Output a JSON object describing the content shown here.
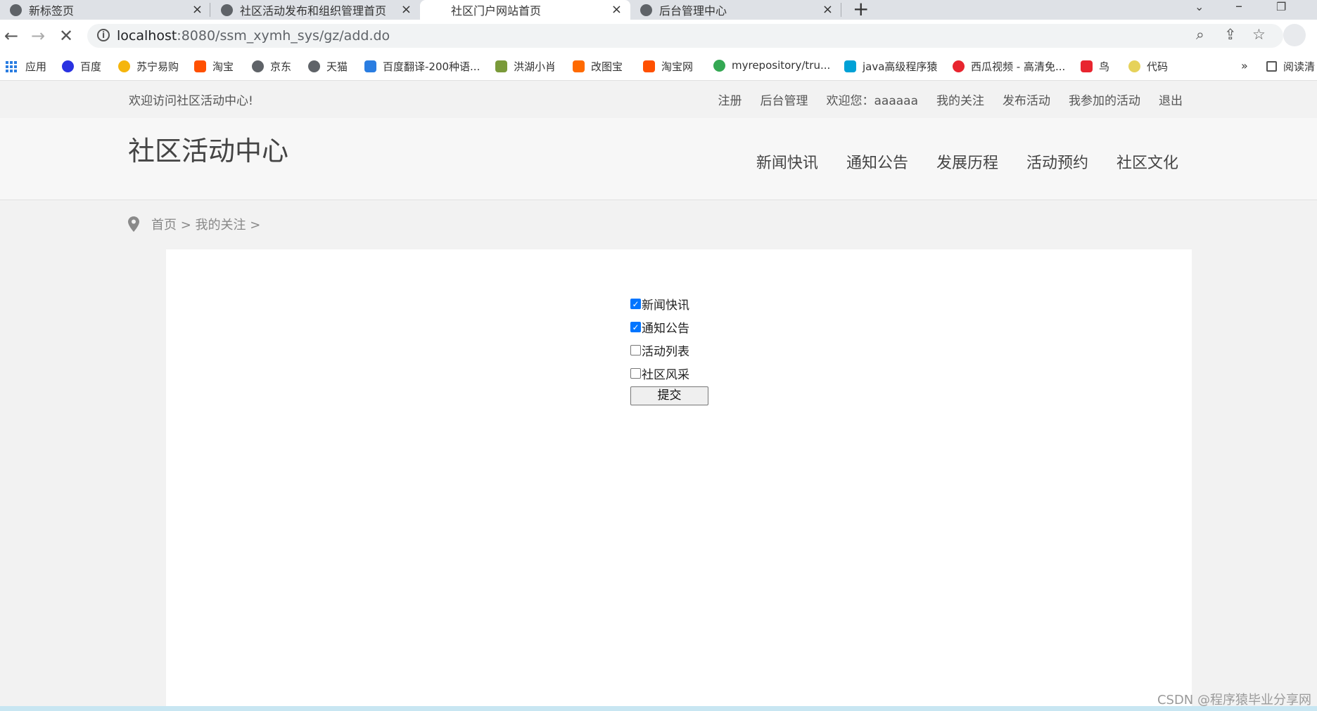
{
  "browser": {
    "tabs": [
      {
        "title": "新标签页",
        "active": false
      },
      {
        "title": "社区活动发布和组织管理首页",
        "active": false
      },
      {
        "title": "社区门户网站首页",
        "active": true
      },
      {
        "title": "后台管理中心",
        "active": false
      }
    ],
    "url_host": "localhost",
    "url_rest": ":8080/ssm_xymh_sys/gz/add.do",
    "bookmarks": [
      {
        "label": "应用",
        "icon": "apps-icon"
      },
      {
        "label": "百度",
        "icon": "baidu-icon",
        "color": "#2932e1"
      },
      {
        "label": "苏宁易购",
        "icon": "suning-icon",
        "color": "#f5b50c"
      },
      {
        "label": "淘宝",
        "icon": "taobao-icon",
        "color": "#ff5000"
      },
      {
        "label": "京东",
        "icon": "globe-icon",
        "color": "#5f6368"
      },
      {
        "label": "天猫",
        "icon": "globe-icon",
        "color": "#5f6368"
      },
      {
        "label": "百度翻译-200种语...",
        "icon": "translate-icon",
        "color": "#2a7de1"
      },
      {
        "label": "洪湖小肖",
        "icon": "bird-icon",
        "color": "#7a9a3a"
      },
      {
        "label": "改图宝",
        "icon": "gaitubao-icon",
        "color": "#ff6a00"
      },
      {
        "label": "淘宝网",
        "icon": "taobao-icon",
        "color": "#ff5000"
      },
      {
        "label": "myrepository/tru...",
        "icon": "chrome-icon",
        "color": "#34a853"
      },
      {
        "label": "java高级程序猿",
        "icon": "bilibili-icon",
        "color": "#00a1d6"
      },
      {
        "label": "西瓜视频 - 高清免...",
        "icon": "xigua-icon",
        "color": "#e8252f"
      },
      {
        "label": "鸟",
        "icon": "bird-red-icon",
        "color": "#e8252f"
      },
      {
        "label": "代码",
        "icon": "code-icon",
        "color": "#e6d25a"
      }
    ],
    "bookmarks_more": "»",
    "reading_list": "阅读清"
  },
  "site": {
    "welcome": "欢迎访问社区活动中心!",
    "toplinks": [
      "注册",
      "后台管理",
      "欢迎您：aaaaaa",
      "我的关注",
      "发布活动",
      "我参加的活动",
      "退出"
    ],
    "title": "社区活动中心",
    "nav": [
      "新闻快讯",
      "通知公告",
      "发展历程",
      "活动预约",
      "社区文化"
    ],
    "breadcrumb": "首页 > 我的关注 >"
  },
  "form": {
    "options": [
      {
        "label": "新闻快讯",
        "checked": true
      },
      {
        "label": "通知公告",
        "checked": true
      },
      {
        "label": "活动列表",
        "checked": false
      },
      {
        "label": "社区风采",
        "checked": false
      }
    ],
    "submit_label": "提交"
  },
  "watermark": "CSDN @程序猿毕业分享网"
}
